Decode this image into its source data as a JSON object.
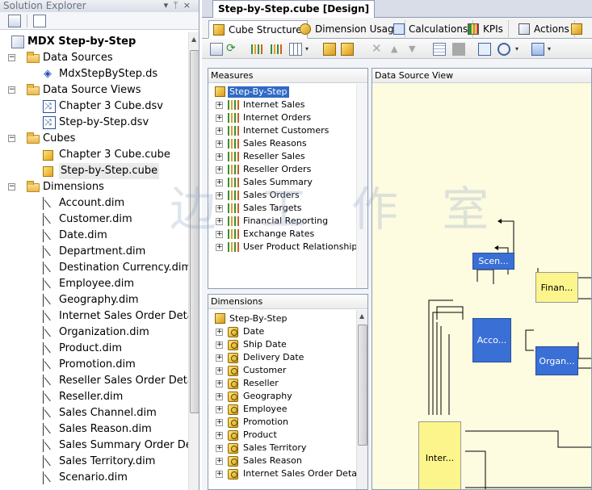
{
  "solution_explorer": {
    "title": "Solution Explorer",
    "title_buttons": [
      "▾",
      "ᛘ",
      "×"
    ],
    "project": "MDX Step-by-Step",
    "tree": [
      {
        "level": 1,
        "kind": "folder",
        "expander": "−",
        "label": "Data Sources"
      },
      {
        "level": 2,
        "kind": "ds",
        "label": "MdxStepByStep.ds"
      },
      {
        "level": 1,
        "kind": "folder",
        "expander": "−",
        "label": "Data Source Views"
      },
      {
        "level": 2,
        "kind": "dsv",
        "label": "Chapter 3 Cube.dsv"
      },
      {
        "level": 2,
        "kind": "dsv",
        "label": "Step-by-Step.dsv"
      },
      {
        "level": 1,
        "kind": "folder",
        "expander": "−",
        "label": "Cubes"
      },
      {
        "level": 2,
        "kind": "cube",
        "label": "Chapter 3 Cube.cube"
      },
      {
        "level": 2,
        "kind": "cube",
        "label": "Step-by-Step.cube",
        "selected": true
      },
      {
        "level": 1,
        "kind": "folder",
        "expander": "−",
        "label": "Dimensions"
      },
      {
        "level": 2,
        "kind": "dim",
        "label": "Account.dim"
      },
      {
        "level": 2,
        "kind": "dim",
        "label": "Customer.dim"
      },
      {
        "level": 2,
        "kind": "dim",
        "label": "Date.dim"
      },
      {
        "level": 2,
        "kind": "dim",
        "label": "Department.dim"
      },
      {
        "level": 2,
        "kind": "dim",
        "label": "Destination Currency.dim"
      },
      {
        "level": 2,
        "kind": "dim",
        "label": "Employee.dim"
      },
      {
        "level": 2,
        "kind": "dim",
        "label": "Geography.dim"
      },
      {
        "level": 2,
        "kind": "dim",
        "label": "Internet Sales Order Details"
      },
      {
        "level": 2,
        "kind": "dim",
        "label": "Organization.dim"
      },
      {
        "level": 2,
        "kind": "dim",
        "label": "Product.dim"
      },
      {
        "level": 2,
        "kind": "dim",
        "label": "Promotion.dim"
      },
      {
        "level": 2,
        "kind": "dim",
        "label": "Reseller Sales Order Detail"
      },
      {
        "level": 2,
        "kind": "dim",
        "label": "Reseller.dim"
      },
      {
        "level": 2,
        "kind": "dim",
        "label": "Sales Channel.dim"
      },
      {
        "level": 2,
        "kind": "dim",
        "label": "Sales Reason.dim"
      },
      {
        "level": 2,
        "kind": "dim",
        "label": "Sales Summary Order Deta"
      },
      {
        "level": 2,
        "kind": "dim",
        "label": "Sales Territory.dim"
      },
      {
        "level": 2,
        "kind": "dim",
        "label": "Scenario.dim"
      }
    ]
  },
  "document": {
    "tab_title": "Step-by-Step.cube [Design]",
    "design_tabs": [
      {
        "label": "Cube Structure",
        "active": true
      },
      {
        "label": "Dimension Usage"
      },
      {
        "label": "Calculations"
      },
      {
        "label": "KPIs"
      },
      {
        "label": "Actions"
      }
    ]
  },
  "measures": {
    "header": "Measures",
    "root": "Step-By-Step",
    "groups": [
      "Internet Sales",
      "Internet Orders",
      "Internet Customers",
      "Sales Reasons",
      "Reseller Sales",
      "Reseller Orders",
      "Sales Summary",
      "Sales Orders",
      "Sales Targets",
      "Financial Reporting",
      "Exchange Rates",
      "User Product Relationship"
    ]
  },
  "dimensions": {
    "header": "Dimensions",
    "root": "Step-By-Step",
    "items": [
      "Date",
      "Ship Date",
      "Delivery Date",
      "Customer",
      "Reseller",
      "Geography",
      "Employee",
      "Promotion",
      "Product",
      "Sales Territory",
      "Sales Reason",
      "Internet Sales Order Details"
    ]
  },
  "dsv": {
    "header": "Data Source View",
    "tables": [
      {
        "label": "Scen...",
        "color": "blue"
      },
      {
        "label": "Finan...",
        "color": "yellow"
      },
      {
        "label": "Acco...",
        "color": "blue"
      },
      {
        "label": "Organ...",
        "color": "blue"
      },
      {
        "label": "Inter...",
        "color": "yellow"
      }
    ]
  },
  "watermark": "边 工 作 室",
  "colors": {
    "selection": "#3169c6",
    "dsv_background": "#fdfbe0",
    "fact_table": "#fbf58c",
    "dimension_table": "#3a6fd6"
  }
}
